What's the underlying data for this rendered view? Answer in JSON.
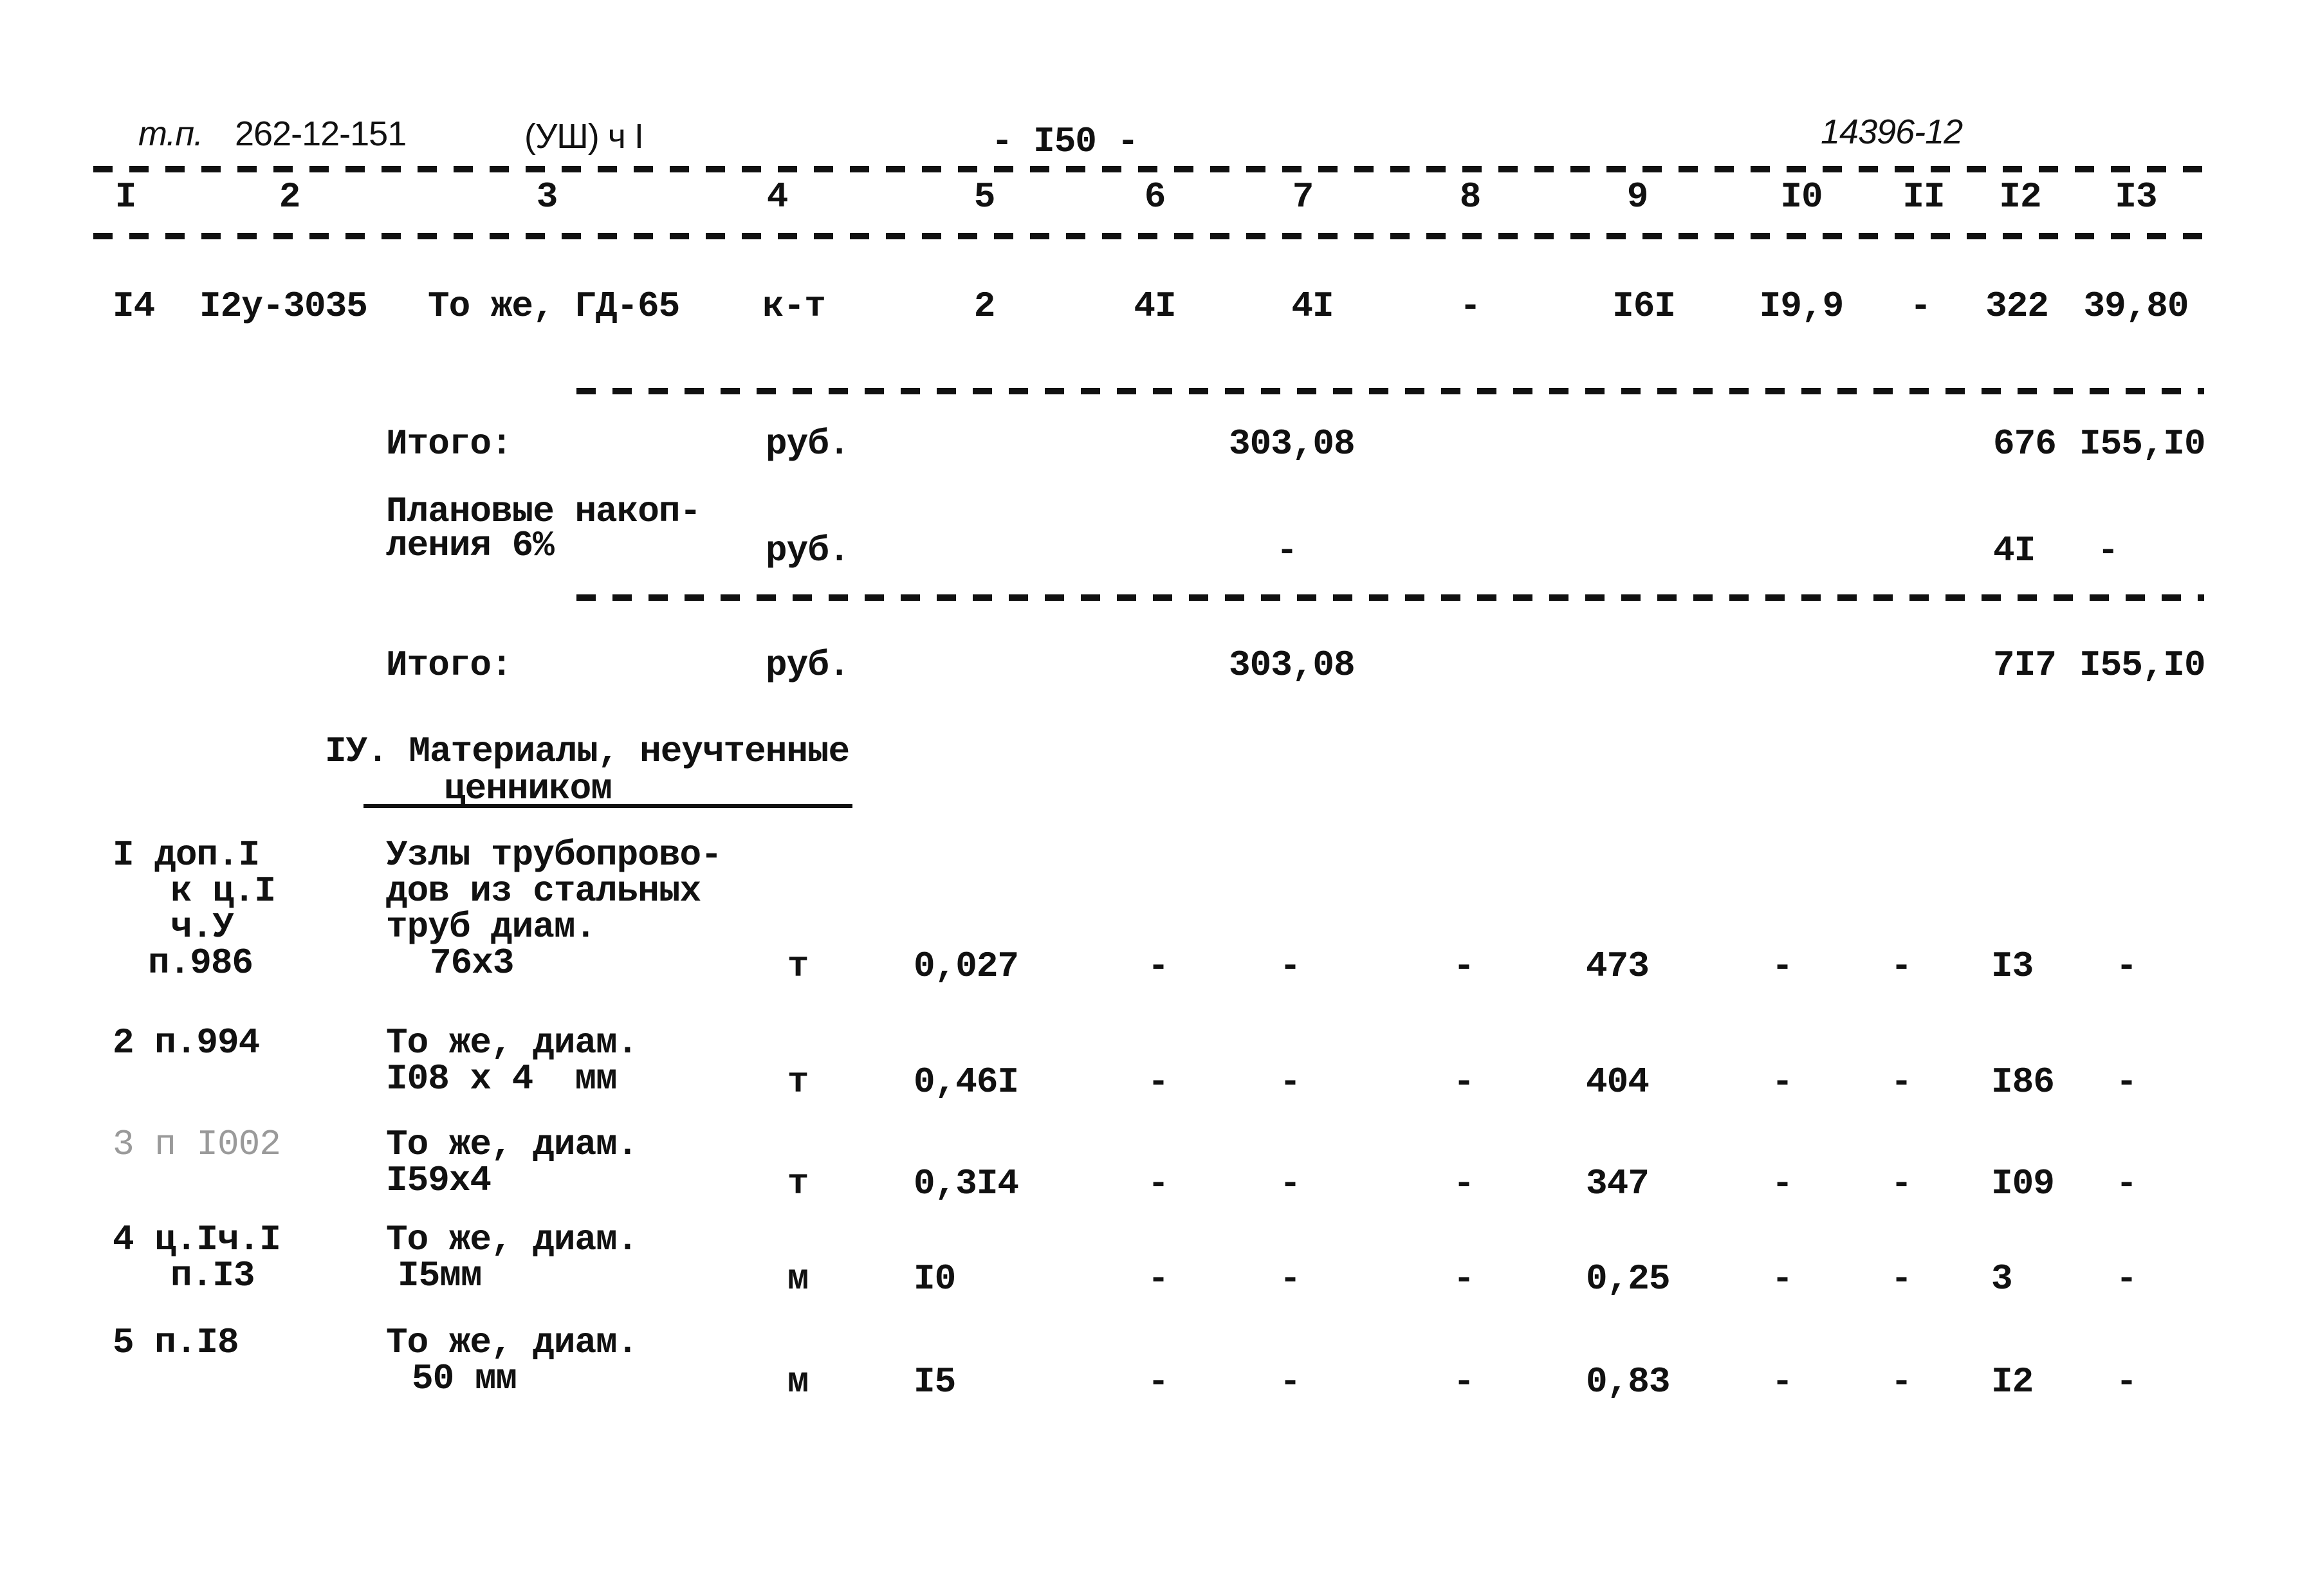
{
  "header": {
    "project_code_prefix": "т.п.",
    "project_code": "262-12-151",
    "section": "(УШ) ч I",
    "page_number": "- I50 -",
    "archive_number": "14396-12"
  },
  "column_numbers": [
    "I",
    "2",
    "3",
    "4",
    "5",
    "6",
    "7",
    "8",
    "9",
    "I0",
    "II",
    "I2",
    "I3"
  ],
  "rows": [
    {
      "c1": "I4",
      "c2": "I2у-3035",
      "c3": "То же, ГД-65",
      "c4": "к-т",
      "c5": "2",
      "c6": "4I",
      "c7": "4I",
      "c8": "-",
      "c9": "I6I",
      "c10": "I9,9",
      "c11": "-",
      "c12": "322",
      "c13": "39,80"
    }
  ],
  "totals": [
    {
      "label": "Итого:",
      "unit": "руб.",
      "c7": "303,08",
      "c12": "676",
      "c13": "I55,I0"
    },
    {
      "label_line1": "Плановые накоп-",
      "label_line2": "ления 6%",
      "unit": "руб.",
      "c7": "-",
      "c12": "4I",
      "c13": "-"
    },
    {
      "label": "Итого:",
      "unit": "руб.",
      "c7": "303,08",
      "c12": "7I7",
      "c13": "I55,I0"
    }
  ],
  "section_heading": {
    "line1": "IУ. Материалы, неучтенные",
    "line2": "ценником"
  },
  "materials": [
    {
      "ref": [
        "I доп.I",
        "к ц.I",
        "ч.У",
        "п.986"
      ],
      "desc": [
        "Узлы трубопрово-",
        "дов из стальных",
        "труб диам.",
        "76х3"
      ],
      "unit": "т",
      "c5": "0,027",
      "c6": "-",
      "c7": "-",
      "c8": "-",
      "c9": "473",
      "c10": "-",
      "c11": "-",
      "c12": "I3",
      "c13": "-"
    },
    {
      "ref": [
        "2 п.994"
      ],
      "desc": [
        "То же, диам.",
        "I08 х 4  мм"
      ],
      "unit": "т",
      "c5": "0,46I",
      "c6": "-",
      "c7": "-",
      "c8": "-",
      "c9": "404",
      "c10": "-",
      "c11": "-",
      "c12": "I86",
      "c13": "-"
    },
    {
      "ref": [
        "3 п I002"
      ],
      "desc": [
        "То же, диам.",
        "I59х4"
      ],
      "unit": "т",
      "c5": "0,3I4",
      "c6": "-",
      "c7": "-",
      "c8": "-",
      "c9": "347",
      "c10": "-",
      "c11": "-",
      "c12": "I09",
      "c13": "-"
    },
    {
      "ref": [
        "4 ц.Iч.I",
        "п.I3"
      ],
      "desc": [
        "То же, диам.",
        "I5мм"
      ],
      "unit": "м",
      "c5": "I0",
      "c6": "-",
      "c7": "-",
      "c8": "-",
      "c9": "0,25",
      "c10": "-",
      "c11": "-",
      "c12": "3",
      "c13": "-"
    },
    {
      "ref": [
        "5 п.I8"
      ],
      "desc": [
        "То же, диам.",
        "50 мм"
      ],
      "unit": "м",
      "c5": "I5",
      "c6": "-",
      "c7": "-",
      "c8": "-",
      "c9": "0,83",
      "c10": "-",
      "c11": "-",
      "c12": "I2",
      "c13": "-"
    }
  ]
}
